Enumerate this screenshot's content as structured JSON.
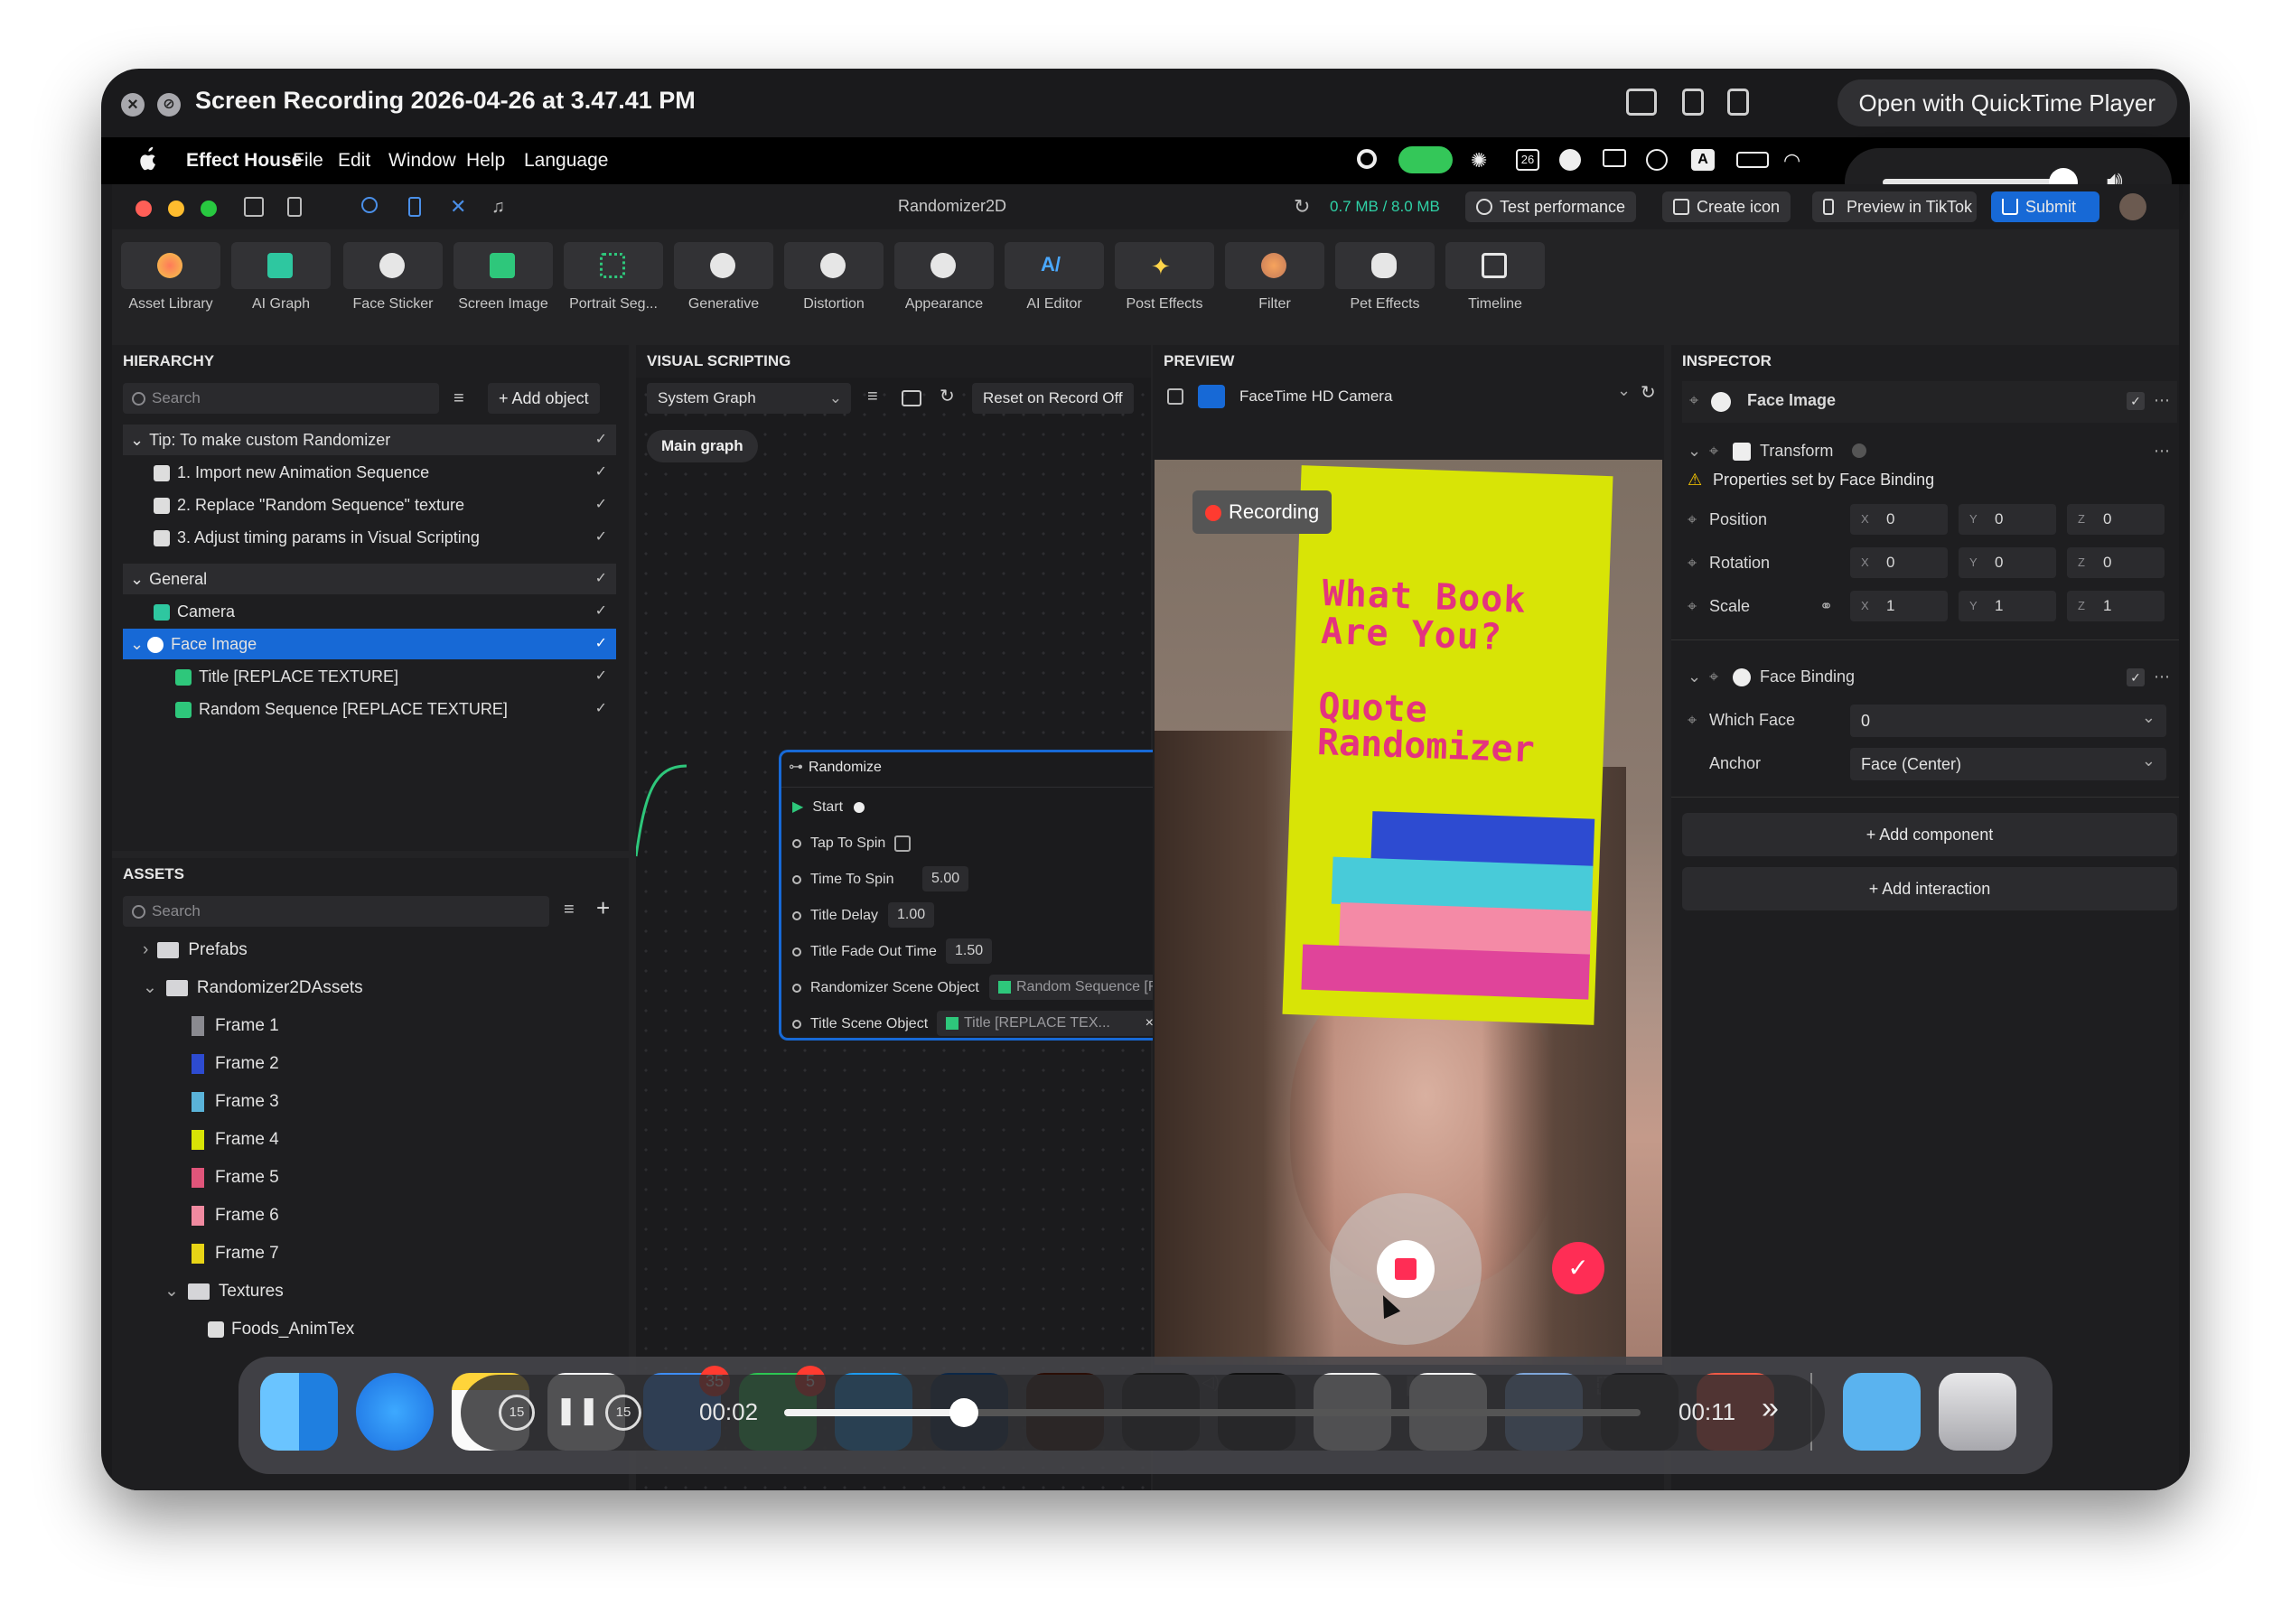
{
  "quicktime": {
    "title": "Screen Recording 2026-04-26 at 3.47.41 PM",
    "open_button": "Open with QuickTime Player"
  },
  "menubar": {
    "items": [
      "Effect House",
      "File",
      "Edit",
      "Window",
      "Help",
      "Language"
    ],
    "date_badge": "26",
    "keyboard_badge": "A"
  },
  "app": {
    "title": "Randomizer2D",
    "memory": "0.7 MB / 8.0 MB",
    "buttons": {
      "test_performance": "Test performance",
      "create_icon": "Create icon",
      "preview_tiktok": "Preview in TikTok",
      "submit": "Submit"
    }
  },
  "toolbar": {
    "tools": [
      "Asset Library",
      "AI Graph",
      "Face Sticker",
      "Screen Image",
      "Portrait Seg...",
      "Generative",
      "Distortion",
      "Appearance",
      "AI Editor",
      "Post Effects",
      "Filter",
      "Pet Effects",
      "Timeline"
    ]
  },
  "hierarchy": {
    "header": "HIERARCHY",
    "search_placeholder": "Search",
    "add_object": "Add object",
    "rows": [
      {
        "label": "Tip: To make custom Randomizer"
      },
      {
        "label": "1. Import new Animation Sequence"
      },
      {
        "label": "2. Replace \"Random Sequence\" texture"
      },
      {
        "label": "3. Adjust timing params in Visual Scripting"
      },
      {
        "label": "General"
      },
      {
        "label": "Camera"
      },
      {
        "label": "Face Image"
      },
      {
        "label": "Title [REPLACE TEXTURE]"
      },
      {
        "label": "Random Sequence [REPLACE TEXTURE]"
      }
    ]
  },
  "assets": {
    "header": "ASSETS",
    "search_placeholder": "Search",
    "rows": [
      {
        "label": "Prefabs",
        "color": ""
      },
      {
        "label": "Randomizer2DAssets",
        "color": ""
      },
      {
        "label": "Frame 1",
        "color": "#8a8a90"
      },
      {
        "label": "Frame 2",
        "color": "#2d4bd1"
      },
      {
        "label": "Frame 3",
        "color": "#5ab3d9"
      },
      {
        "label": "Frame 4",
        "color": "#d8e406"
      },
      {
        "label": "Frame 5",
        "color": "#e0557a"
      },
      {
        "label": "Frame 6",
        "color": "#f08aa0"
      },
      {
        "label": "Frame 7",
        "color": "#e8d416"
      },
      {
        "label": "Textures",
        "color": ""
      },
      {
        "label": "Foods_AnimTex",
        "color": ""
      }
    ]
  },
  "visual_scripting": {
    "header": "VISUAL SCRIPTING",
    "graph_select": "System Graph",
    "reset_label": "Reset on Record Off",
    "main_graph": "Main graph",
    "node": {
      "title": "Randomize",
      "start": "Start",
      "tap_to_spin": "Tap To Spin",
      "time_to_spin_label": "Time To Spin",
      "time_to_spin": "5.00",
      "title_delay_label": "Title Delay",
      "title_delay": "1.00",
      "title_fade_label": "Title Fade Out Time",
      "title_fade": "1.50",
      "scene_obj_label": "Randomizer Scene Object",
      "scene_obj": "Random Sequence [R...",
      "title_obj_label": "Title Scene Object",
      "title_obj": "Title [REPLACE TEX..."
    }
  },
  "preview": {
    "header": "PREVIEW",
    "camera": "FaceTime HD Camera",
    "recording": "Recording",
    "card_title": "What Book Are You?",
    "card_subtitle": "Quote Randomizer"
  },
  "inspector": {
    "header": "INSPECTOR",
    "object": "Face Image",
    "transform": "Transform",
    "warning": "Properties set by Face Binding",
    "position": "Position",
    "rotation": "Rotation",
    "scale": "Scale",
    "pos": [
      "0",
      "0",
      "0"
    ],
    "rot": [
      "0",
      "0",
      "0"
    ],
    "scl": [
      "1",
      "1",
      "1"
    ],
    "face_binding": "Face Binding",
    "which_face": "Which Face",
    "which_face_value": "0",
    "anchor": "Anchor",
    "anchor_value": "Face (Center)",
    "add_component": "Add component",
    "add_interaction": "Add interaction"
  },
  "dock": {
    "badges": [
      "35",
      "5"
    ]
  },
  "player": {
    "time_elapsed": "00:02",
    "time_total": "00:11",
    "skip_seconds": "15",
    "progress": 0.21
  }
}
